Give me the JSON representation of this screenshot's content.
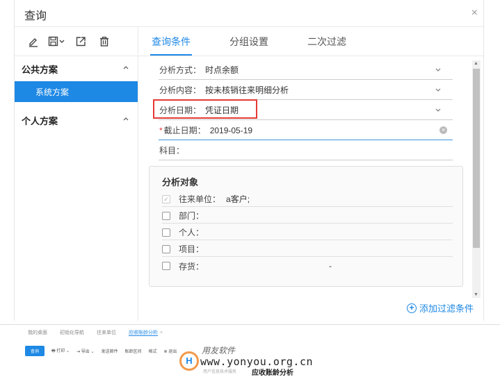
{
  "dialog": {
    "title": "查询",
    "close": "×"
  },
  "toolbar": {
    "icons": [
      "edit-icon",
      "save-icon",
      "export-icon",
      "delete-icon"
    ],
    "save_dropdown": "⌄"
  },
  "schemes": {
    "public_label": "公共方案",
    "system_item": "系统方案",
    "personal_label": "个人方案"
  },
  "tabs": [
    {
      "label": "查询条件",
      "active": true
    },
    {
      "label": "分组设置",
      "active": false
    },
    {
      "label": "二次过滤",
      "active": false
    }
  ],
  "form": {
    "analysis_method": {
      "label": "分析方式：",
      "value": "时点余额"
    },
    "analysis_content": {
      "label": "分析内容：",
      "value": "按未核销往来明细分析"
    },
    "analysis_date": {
      "label": "分析日期：",
      "value": "凭证日期"
    },
    "cutoff_date": {
      "required_mark": "*",
      "label": "截止日期：",
      "value": "2019-05-19"
    },
    "subject": {
      "label": "科目：",
      "value": ""
    }
  },
  "analysis_objects": {
    "title": "分析对象",
    "items": [
      {
        "label": "往来单位：",
        "value": "a客户;",
        "checked": true
      },
      {
        "label": "部门：",
        "value": "",
        "checked": false
      },
      {
        "label": "个人：",
        "value": "",
        "checked": false
      },
      {
        "label": "项目：",
        "value": "",
        "checked": false
      },
      {
        "label": "存货：",
        "value": "",
        "checked": false,
        "extra": "-"
      }
    ]
  },
  "add_filter": {
    "plus": "+",
    "label": "添加过滤条件"
  },
  "bottom": {
    "tabs": [
      {
        "label": "我的桌面",
        "active": false
      },
      {
        "label": "初始化导航",
        "active": false
      },
      {
        "label": "往来单位",
        "active": false
      },
      {
        "label": "应收账龄分析",
        "active": true,
        "close": "×"
      }
    ],
    "toolbar": [
      "查询",
      "打印",
      "导出",
      "发送邮件",
      "账龄区间",
      "格式",
      "退出"
    ],
    "watermark_cn": "用友软件",
    "watermark_url": "www.yonyou.org.cn",
    "watermark_sub": "用户信息技术服务",
    "page_title": "应收账龄分析"
  },
  "colors": {
    "accent": "#1e88e5",
    "highlight": "#e53935",
    "required": "#e53935"
  }
}
